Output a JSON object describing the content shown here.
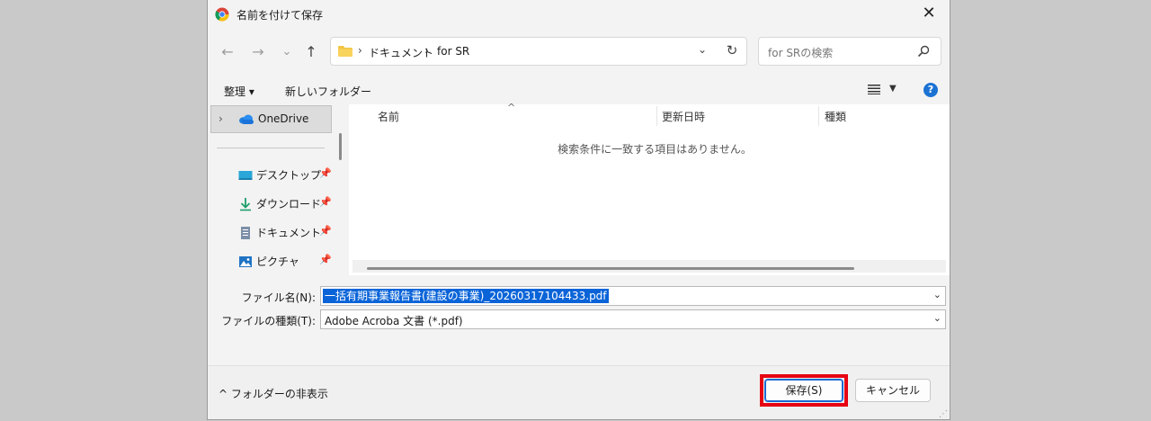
{
  "window": {
    "title": "名前を付けて保存",
    "close": "✕"
  },
  "nav": {
    "back": "←",
    "forward": "→",
    "recent": "⌄",
    "up": "↑",
    "breadcrumb": [
      "ドキュメント",
      "for SR"
    ],
    "separator": "›",
    "address_dropdown": "⌄",
    "refresh": "↻",
    "search_placeholder": "for SRの検索"
  },
  "commands": {
    "organize": "整理 ▾",
    "new_folder": "新しいフォルダー",
    "view_drop": "▼",
    "help": "?"
  },
  "sidebar": {
    "onedrive": "OneDrive",
    "chevron": "›",
    "items": [
      {
        "label": "デスクトップ",
        "icon": "desktop-icon"
      },
      {
        "label": "ダウンロード",
        "icon": "download-icon"
      },
      {
        "label": "ドキュメント",
        "icon": "document-icon"
      },
      {
        "label": "ピクチャ",
        "icon": "pictures-icon"
      }
    ],
    "pin": "📌"
  },
  "filelist": {
    "columns": [
      "名前",
      "更新日時",
      "種類"
    ],
    "sort_arrow": "^",
    "empty_message": "検索条件に一致する項目はありません。"
  },
  "form": {
    "filename_label": "ファイル名(N):",
    "filename_value": "一括有期事業報告書(建設の事業)_20260317104433.pdf",
    "filetype_label": "ファイルの種類(T):",
    "filetype_value": "Adobe Acroba 文書 (*.pdf)",
    "dropdown": "⌄"
  },
  "footer": {
    "hide_folders": "^ フォルダーの非表示",
    "save": "保存(S)",
    "cancel": "キャンセル"
  },
  "colors": {
    "highlight": "#e60012",
    "accent": "#0a64d8"
  }
}
